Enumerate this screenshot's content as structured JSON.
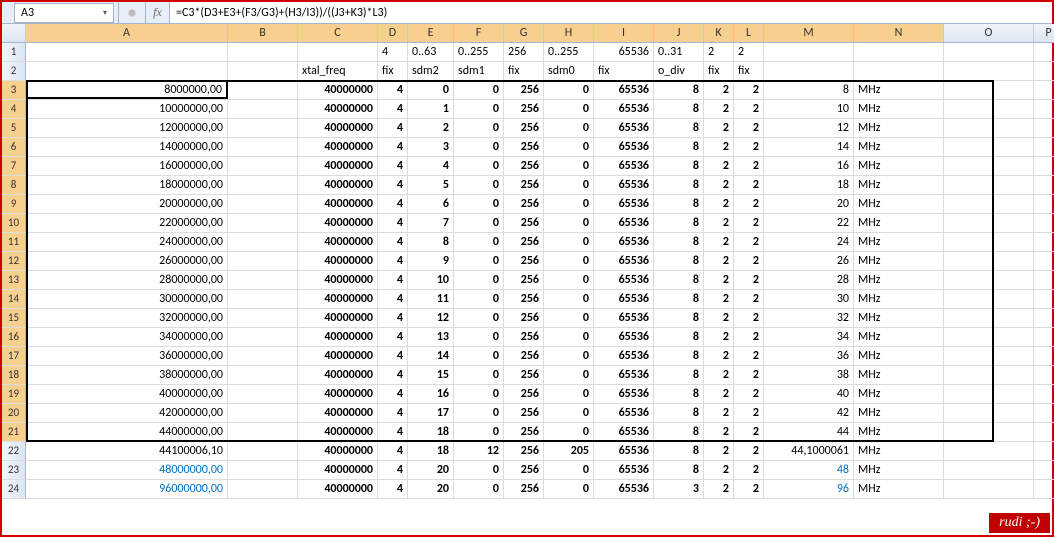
{
  "name_box": "A3",
  "fx_label": "fx",
  "formula": "=C3*(D3+E3+(F3/G3)+(H3/I3))/((J3+K3)*L3)",
  "col_letters": [
    "A",
    "B",
    "C",
    "D",
    "E",
    "F",
    "G",
    "H",
    "I",
    "J",
    "K",
    "L",
    "M",
    "N",
    "O",
    "P"
  ],
  "row1": {
    "D": "4",
    "E": "0..63",
    "F": "0..255",
    "G": "256",
    "H": "0..255",
    "I": "65536",
    "J": "0..31",
    "K": "2",
    "L": "2"
  },
  "row2": {
    "C": "xtal_freq",
    "D": "fix",
    "E": "sdm2",
    "F": "sdm1",
    "G": "fix",
    "H": "sdm0",
    "I": "fix",
    "J": "o_div",
    "K": "fix",
    "L": "fix"
  },
  "chart_data": {
    "type": "table",
    "columns": [
      "row",
      "A",
      "C",
      "D",
      "E",
      "F",
      "G",
      "H",
      "I",
      "J",
      "K",
      "L",
      "M",
      "N"
    ],
    "rows": [
      {
        "row": 3,
        "A": "8000000,00",
        "C": "40000000",
        "D": "4",
        "E": "0",
        "F": "0",
        "G": "256",
        "H": "0",
        "I": "65536",
        "J": "8",
        "K": "2",
        "L": "2",
        "M": "8",
        "N": "MHz"
      },
      {
        "row": 4,
        "A": "10000000,00",
        "C": "40000000",
        "D": "4",
        "E": "1",
        "F": "0",
        "G": "256",
        "H": "0",
        "I": "65536",
        "J": "8",
        "K": "2",
        "L": "2",
        "M": "10",
        "N": "MHz"
      },
      {
        "row": 5,
        "A": "12000000,00",
        "C": "40000000",
        "D": "4",
        "E": "2",
        "F": "0",
        "G": "256",
        "H": "0",
        "I": "65536",
        "J": "8",
        "K": "2",
        "L": "2",
        "M": "12",
        "N": "MHz"
      },
      {
        "row": 6,
        "A": "14000000,00",
        "C": "40000000",
        "D": "4",
        "E": "3",
        "F": "0",
        "G": "256",
        "H": "0",
        "I": "65536",
        "J": "8",
        "K": "2",
        "L": "2",
        "M": "14",
        "N": "MHz"
      },
      {
        "row": 7,
        "A": "16000000,00",
        "C": "40000000",
        "D": "4",
        "E": "4",
        "F": "0",
        "G": "256",
        "H": "0",
        "I": "65536",
        "J": "8",
        "K": "2",
        "L": "2",
        "M": "16",
        "N": "MHz"
      },
      {
        "row": 8,
        "A": "18000000,00",
        "C": "40000000",
        "D": "4",
        "E": "5",
        "F": "0",
        "G": "256",
        "H": "0",
        "I": "65536",
        "J": "8",
        "K": "2",
        "L": "2",
        "M": "18",
        "N": "MHz"
      },
      {
        "row": 9,
        "A": "20000000,00",
        "C": "40000000",
        "D": "4",
        "E": "6",
        "F": "0",
        "G": "256",
        "H": "0",
        "I": "65536",
        "J": "8",
        "K": "2",
        "L": "2",
        "M": "20",
        "N": "MHz"
      },
      {
        "row": 10,
        "A": "22000000,00",
        "C": "40000000",
        "D": "4",
        "E": "7",
        "F": "0",
        "G": "256",
        "H": "0",
        "I": "65536",
        "J": "8",
        "K": "2",
        "L": "2",
        "M": "22",
        "N": "MHz"
      },
      {
        "row": 11,
        "A": "24000000,00",
        "C": "40000000",
        "D": "4",
        "E": "8",
        "F": "0",
        "G": "256",
        "H": "0",
        "I": "65536",
        "J": "8",
        "K": "2",
        "L": "2",
        "M": "24",
        "N": "MHz"
      },
      {
        "row": 12,
        "A": "26000000,00",
        "C": "40000000",
        "D": "4",
        "E": "9",
        "F": "0",
        "G": "256",
        "H": "0",
        "I": "65536",
        "J": "8",
        "K": "2",
        "L": "2",
        "M": "26",
        "N": "MHz"
      },
      {
        "row": 13,
        "A": "28000000,00",
        "C": "40000000",
        "D": "4",
        "E": "10",
        "F": "0",
        "G": "256",
        "H": "0",
        "I": "65536",
        "J": "8",
        "K": "2",
        "L": "2",
        "M": "28",
        "N": "MHz"
      },
      {
        "row": 14,
        "A": "30000000,00",
        "C": "40000000",
        "D": "4",
        "E": "11",
        "F": "0",
        "G": "256",
        "H": "0",
        "I": "65536",
        "J": "8",
        "K": "2",
        "L": "2",
        "M": "30",
        "N": "MHz"
      },
      {
        "row": 15,
        "A": "32000000,00",
        "C": "40000000",
        "D": "4",
        "E": "12",
        "F": "0",
        "G": "256",
        "H": "0",
        "I": "65536",
        "J": "8",
        "K": "2",
        "L": "2",
        "M": "32",
        "N": "MHz"
      },
      {
        "row": 16,
        "A": "34000000,00",
        "C": "40000000",
        "D": "4",
        "E": "13",
        "F": "0",
        "G": "256",
        "H": "0",
        "I": "65536",
        "J": "8",
        "K": "2",
        "L": "2",
        "M": "34",
        "N": "MHz"
      },
      {
        "row": 17,
        "A": "36000000,00",
        "C": "40000000",
        "D": "4",
        "E": "14",
        "F": "0",
        "G": "256",
        "H": "0",
        "I": "65536",
        "J": "8",
        "K": "2",
        "L": "2",
        "M": "36",
        "N": "MHz"
      },
      {
        "row": 18,
        "A": "38000000,00",
        "C": "40000000",
        "D": "4",
        "E": "15",
        "F": "0",
        "G": "256",
        "H": "0",
        "I": "65536",
        "J": "8",
        "K": "2",
        "L": "2",
        "M": "38",
        "N": "MHz"
      },
      {
        "row": 19,
        "A": "40000000,00",
        "C": "40000000",
        "D": "4",
        "E": "16",
        "F": "0",
        "G": "256",
        "H": "0",
        "I": "65536",
        "J": "8",
        "K": "2",
        "L": "2",
        "M": "40",
        "N": "MHz"
      },
      {
        "row": 20,
        "A": "42000000,00",
        "C": "40000000",
        "D": "4",
        "E": "17",
        "F": "0",
        "G": "256",
        "H": "0",
        "I": "65536",
        "J": "8",
        "K": "2",
        "L": "2",
        "M": "42",
        "N": "MHz"
      },
      {
        "row": 21,
        "A": "44000000,00",
        "C": "40000000",
        "D": "4",
        "E": "18",
        "F": "0",
        "G": "256",
        "H": "0",
        "I": "65536",
        "J": "8",
        "K": "2",
        "L": "2",
        "M": "44",
        "N": "MHz"
      },
      {
        "row": 22,
        "A": "44100006,10",
        "C": "40000000",
        "D": "4",
        "E": "18",
        "F": "12",
        "G": "256",
        "H": "205",
        "I": "65536",
        "J": "8",
        "K": "2",
        "L": "2",
        "M": "44,1000061",
        "N": "MHz"
      },
      {
        "row": 23,
        "A": "48000000,00",
        "C": "40000000",
        "D": "4",
        "E": "20",
        "F": "0",
        "G": "256",
        "H": "0",
        "I": "65536",
        "J": "8",
        "K": "2",
        "L": "2",
        "M": "48",
        "N": "MHz",
        "blue": true
      },
      {
        "row": 24,
        "A": "96000000,00",
        "C": "40000000",
        "D": "4",
        "E": "20",
        "F": "0",
        "G": "256",
        "H": "0",
        "I": "65536",
        "J": "3",
        "K": "2",
        "L": "2",
        "M": "96",
        "N": "MHz",
        "blue": true
      }
    ]
  },
  "rudi": "rudi ;-)"
}
